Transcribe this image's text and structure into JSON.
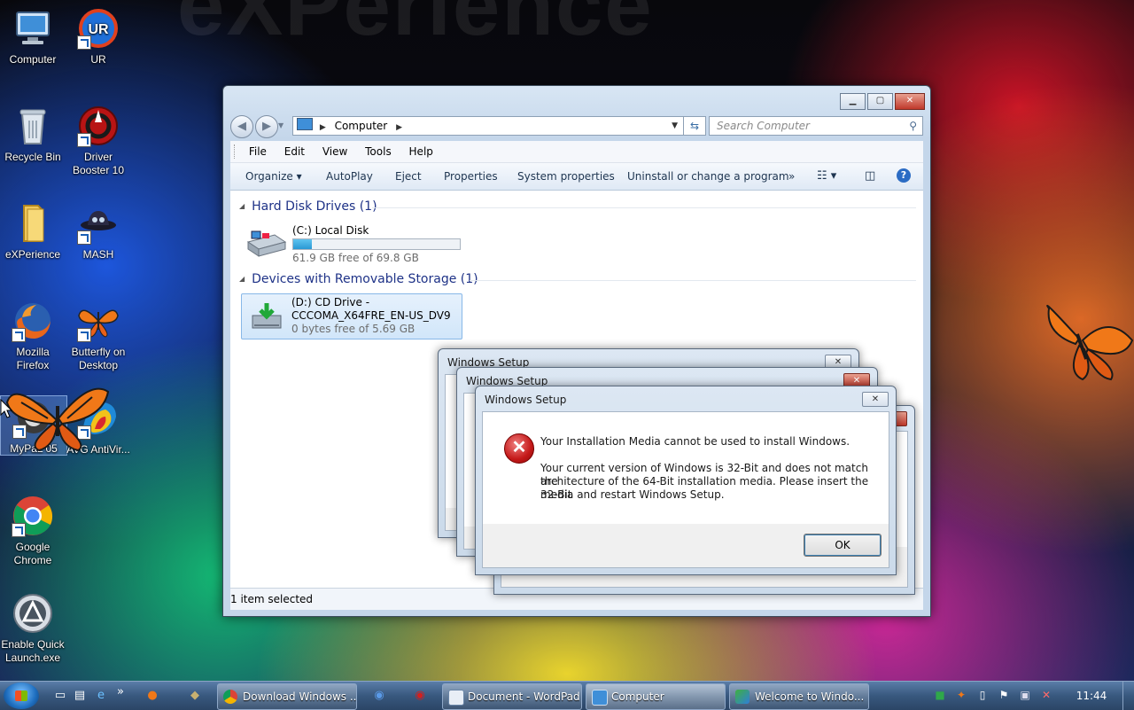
{
  "desktop": {
    "watermark": "eXPerience",
    "icons": [
      {
        "label": "Computer"
      },
      {
        "label": "UR"
      },
      {
        "label": "Recycle Bin"
      },
      {
        "label": "Driver Booster 10"
      },
      {
        "label": "eXPerience"
      },
      {
        "label": "MASH"
      },
      {
        "label": "Mozilla Firefox"
      },
      {
        "label": "Butterfly on Desktop"
      },
      {
        "label": "MyPaL 05"
      },
      {
        "label": "AVG AntiVir..."
      },
      {
        "label": "Google Chrome"
      },
      {
        "label": "Enable Quick Launch.exe"
      }
    ]
  },
  "explorer": {
    "breadcrumb": "Computer",
    "search_placeholder": "Search Computer",
    "menu": [
      "File",
      "Edit",
      "View",
      "Tools",
      "Help"
    ],
    "toolbar": [
      "Organize ▾",
      "AutoPlay",
      "Eject",
      "Properties",
      "System properties",
      "Uninstall or change a program",
      "»"
    ],
    "groups": [
      {
        "header": "Hard Disk Drives (1)"
      },
      {
        "header": "Devices with Removable Storage (1)"
      }
    ],
    "drives": [
      {
        "name": "(C:) Local Disk",
        "free": "61.9 GB free of 69.8 GB",
        "used_fraction": 0.11
      },
      {
        "name": "(D:) CD Drive - CCCOMA_X64FRE_EN-US_DV9",
        "free": "0 bytes free of 5.69 GB"
      }
    ],
    "status": "1 item selected"
  },
  "setup_dialog": {
    "title": "Windows Setup",
    "close_glyph": "✕",
    "error_glyph": "✕",
    "line1": "Your Installation Media cannot be used to install Windows.",
    "line2": "Your current version of Windows is 32-Bit and does not match the",
    "line3": "architecture of the 64-Bit installation media. Please insert the 32-Bit",
    "line4": "media and restart Windows Setup.",
    "ok": "OK"
  },
  "taskbar": {
    "quick_launch_more": "»",
    "buttons": [
      {
        "label": "Download Windows ..."
      },
      {
        "label": "Document - WordPad"
      },
      {
        "label": "Computer"
      },
      {
        "label": "Welcome to Windo..."
      }
    ],
    "clock": "11:44"
  },
  "colors": {
    "title_text": "#1e3287",
    "progress": "#2a98d4",
    "error": "#c41818"
  }
}
